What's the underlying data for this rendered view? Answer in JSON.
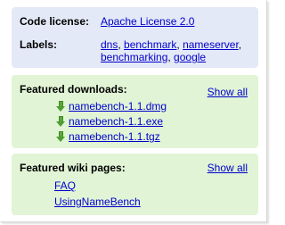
{
  "license": {
    "heading": "Code license:",
    "value": "Apache License 2.0",
    "labels_heading": "Labels:",
    "labels": [
      "dns",
      "benchmark",
      "nameserver",
      "benchmarking",
      "google"
    ]
  },
  "downloads": {
    "heading": "Featured downloads:",
    "show_all": "Show all",
    "items": [
      "namebench-1.1.dmg",
      "namebench-1.1.exe",
      "namebench-1.1.tgz"
    ]
  },
  "wiki": {
    "heading": "Featured wiki pages:",
    "show_all": "Show all",
    "items": [
      "FAQ",
      "UsingNameBench"
    ]
  },
  "colors": {
    "license_bg": "#e4e9f7",
    "featured_bg": "#e1f5d6",
    "link": "#0000cc",
    "download_arrow": "#5aa93a"
  },
  "icons": {
    "download": "download-arrow-icon"
  }
}
